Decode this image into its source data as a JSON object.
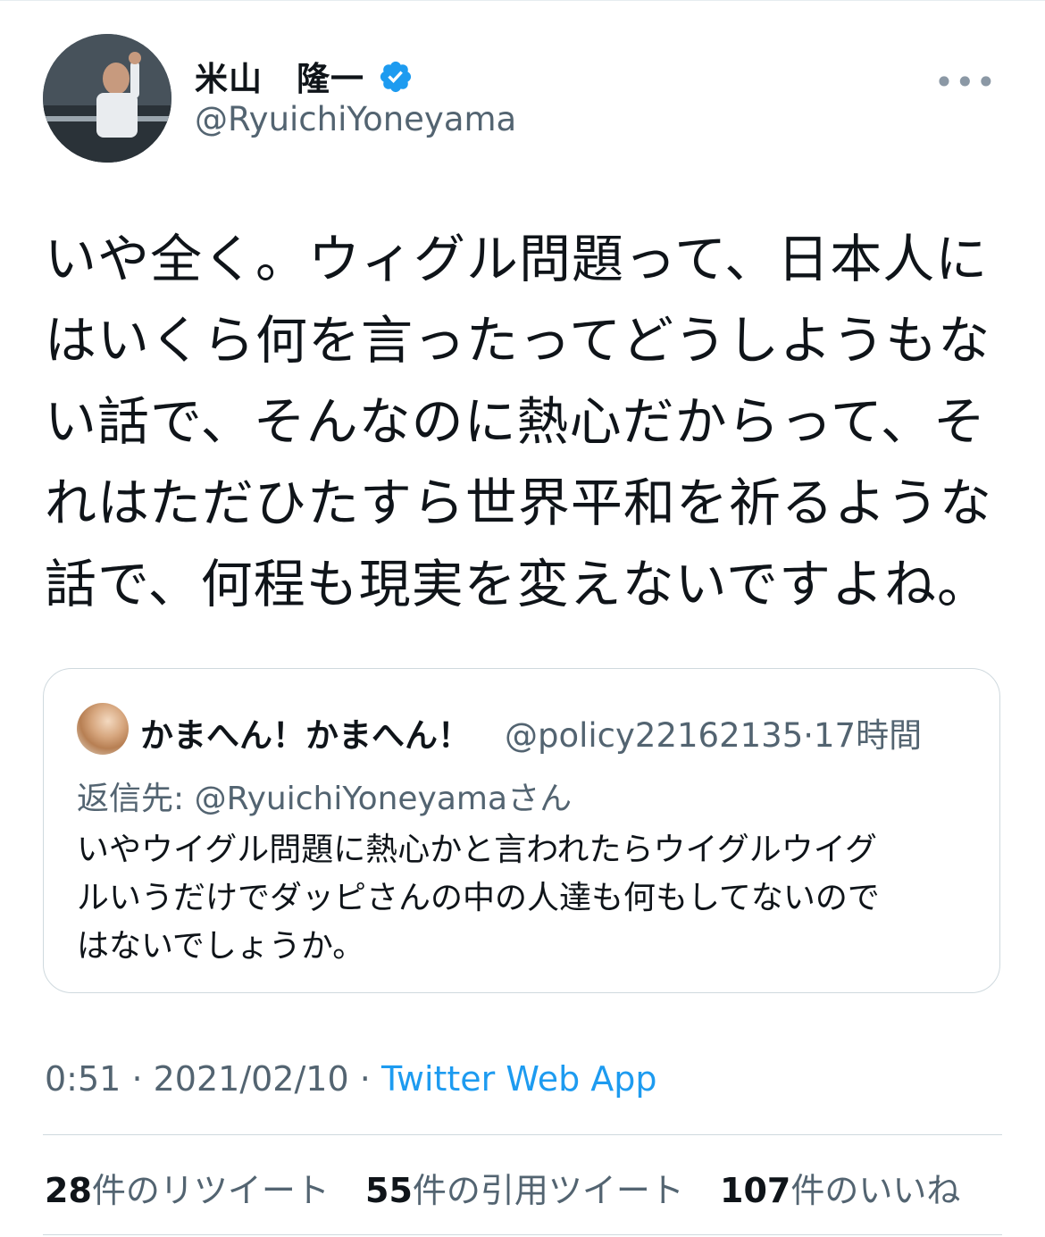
{
  "tweet": {
    "display_name": "米山　隆一",
    "handle": "@RyuichiYoneyama",
    "verified": true,
    "more_icon": "•••",
    "text": "いや全く。ウィグル問題って、日本人に\nはいくら何を言ったってどうしようもな\nい話で、そんなのに熱心だからって、そ\nれはただひたすら世界平和を祈るような\n話で、何程も現実を変えないですよね。",
    "time": "0:51",
    "date": "2021/02/10",
    "app": "Twitter Web App",
    "separator": "·"
  },
  "quote": {
    "display_name": "かまへん！かまへん！",
    "handle": "@policy22162135",
    "separator": "·",
    "time_ago": "17時間",
    "reply_prefix": "返信先: ",
    "reply_to": "@RyuichiYoneyama",
    "reply_suffix": "さん",
    "text": "いやウイグル問題に熱心かと言われたらウイグルウイグ\nルいうだけでダッピさんの中の人達も何もしてないので\nはないでしょうか。"
  },
  "stats": {
    "retweets_count": "28",
    "retweets_label": "件のリツイート",
    "quotes_count": "55",
    "quotes_label": "件の引用ツイート",
    "likes_count": "107",
    "likes_label": "件のいいね"
  },
  "colors": {
    "accent": "#1d9bf0",
    "secondary_text": "#536471",
    "primary_text": "#0f1419",
    "border": "#cfd9de"
  },
  "icons": {
    "verified": "verified-badge-icon",
    "more": "more-icon"
  }
}
